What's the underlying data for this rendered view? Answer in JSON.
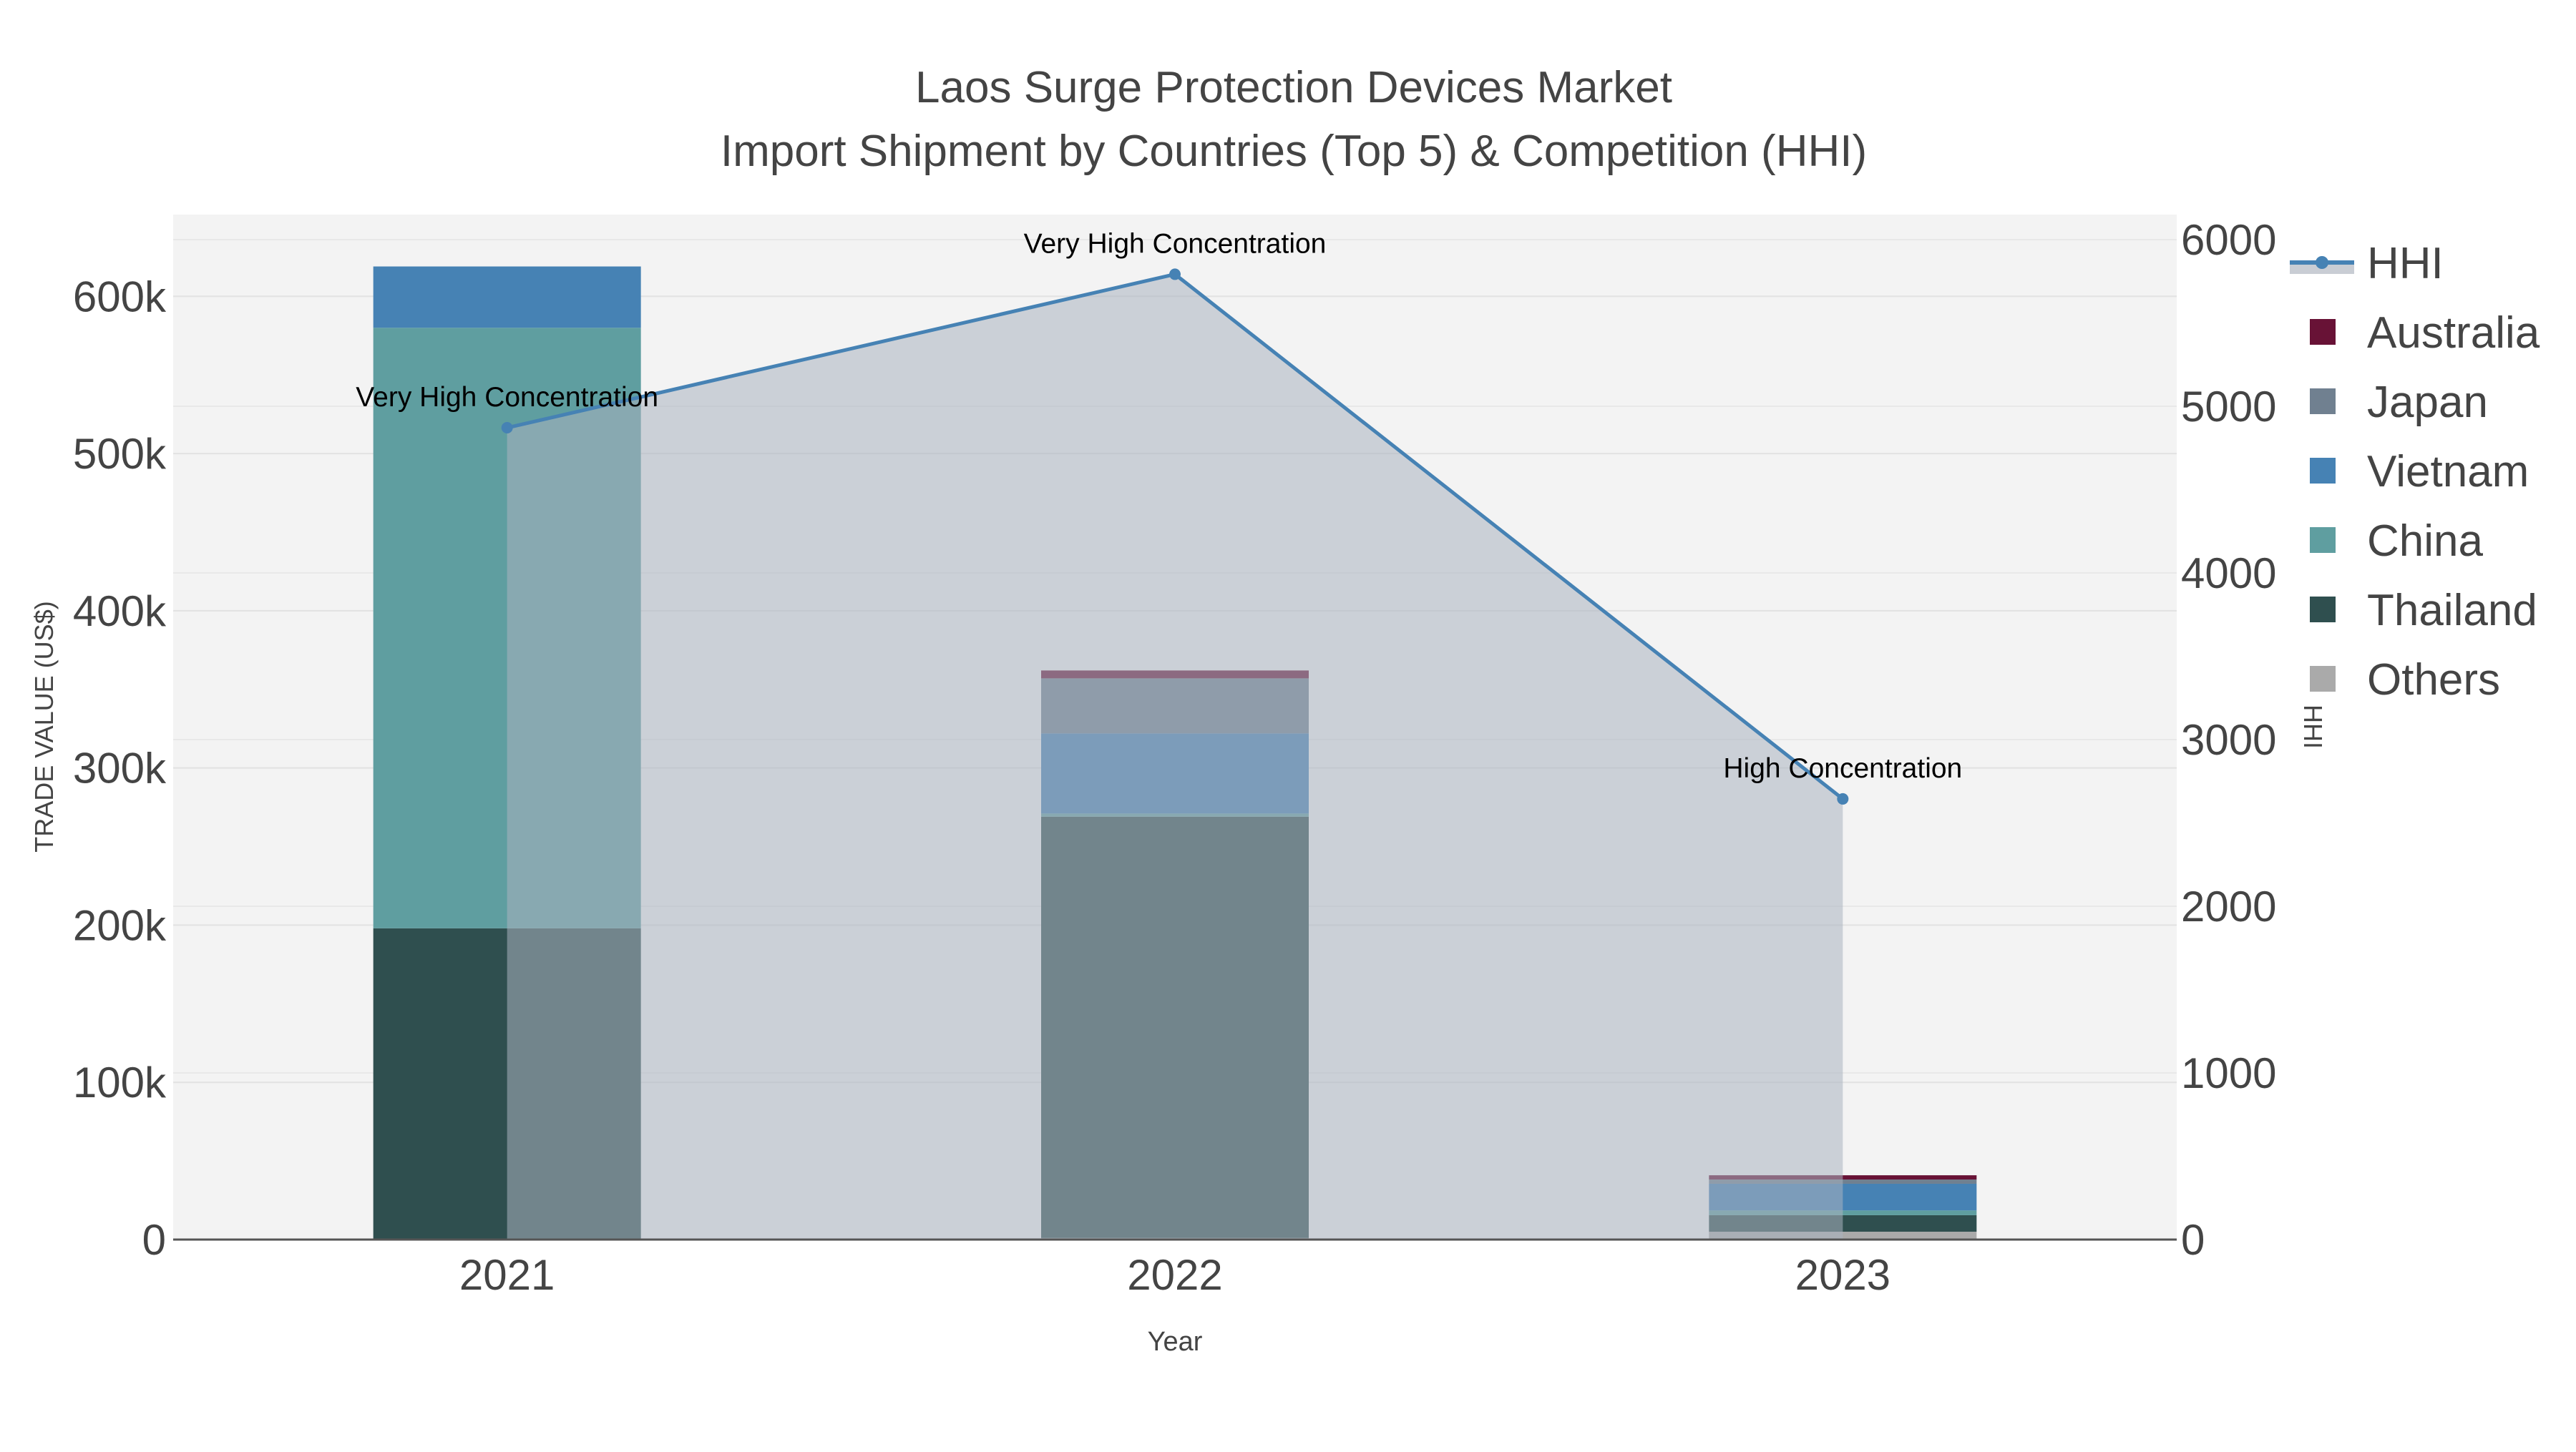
{
  "chart_data": {
    "type": "bar",
    "stacked": true,
    "title": "Laos Surge Protection Devices Market",
    "subtitle": "Import Shipment by Countries (Top 5) & Competition (HHI)",
    "xlabel": "Year",
    "ylabel": "TRADE VALUE (US$)",
    "y2label": "HHI",
    "categories": [
      "2021",
      "2022",
      "2023"
    ],
    "ylim": [
      0,
      652000
    ],
    "y2lim": [
      0,
      6150
    ],
    "yticks": [
      0,
      100000,
      200000,
      300000,
      400000,
      500000,
      600000
    ],
    "ytick_labels": [
      "0",
      "100k",
      "200k",
      "300k",
      "400k",
      "500k",
      "600k"
    ],
    "y2ticks": [
      0,
      1000,
      2000,
      3000,
      4000,
      5000,
      6000
    ],
    "y2tick_labels": [
      "0",
      "1000",
      "2000",
      "3000",
      "4000",
      "5000",
      "6000"
    ],
    "series": [
      {
        "name": "Others",
        "color": "#aaaaaa",
        "values": [
          0,
          1000,
          5000
        ]
      },
      {
        "name": "Thailand",
        "color": "#2f4f4f",
        "values": [
          198000,
          268000,
          10500
        ]
      },
      {
        "name": "China",
        "color": "#5f9ea0",
        "values": [
          382000,
          2000,
          3000
        ]
      },
      {
        "name": "Vietnam",
        "color": "#4682b4",
        "values": [
          39000,
          51000,
          17000
        ]
      },
      {
        "name": "Japan",
        "color": "#708090",
        "values": [
          0,
          35000,
          2700
        ]
      },
      {
        "name": "Australia",
        "color": "#681236",
        "values": [
          0,
          5000,
          2700
        ]
      }
    ],
    "hhi": {
      "name": "HHI",
      "color": "#4682b4",
      "fill": "#c9cdd4",
      "values": [
        4871,
        5792,
        2644
      ],
      "annotations": [
        "Very High Concentration",
        "Very High Concentration",
        "High Concentration"
      ]
    },
    "legend_order": [
      "HHI",
      "Australia",
      "Japan",
      "Vietnam",
      "China",
      "Thailand",
      "Others"
    ],
    "legend_position": "right",
    "grid": true
  }
}
